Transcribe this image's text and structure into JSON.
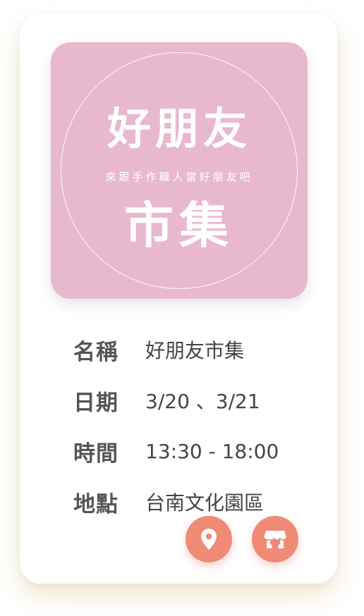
{
  "logo": {
    "title": "好朋友",
    "subtitle": "來跟手作職人當好朋友吧",
    "main": "市集"
  },
  "details": [
    {
      "label": "名稱",
      "value": "好朋友市集"
    },
    {
      "label": "日期",
      "value": "3/20 、3/21"
    },
    {
      "label": "時間",
      "value": "13:30 - 18:00"
    },
    {
      "label": "地點",
      "value": "台南文化園區"
    }
  ],
  "actions": {
    "location_icon": "location-pin-icon",
    "store_icon": "storefront-icon"
  },
  "colors": {
    "logo_bg": "#e8b8cf",
    "accent": "#ee8a76",
    "label": "#555555",
    "value": "#444444"
  }
}
